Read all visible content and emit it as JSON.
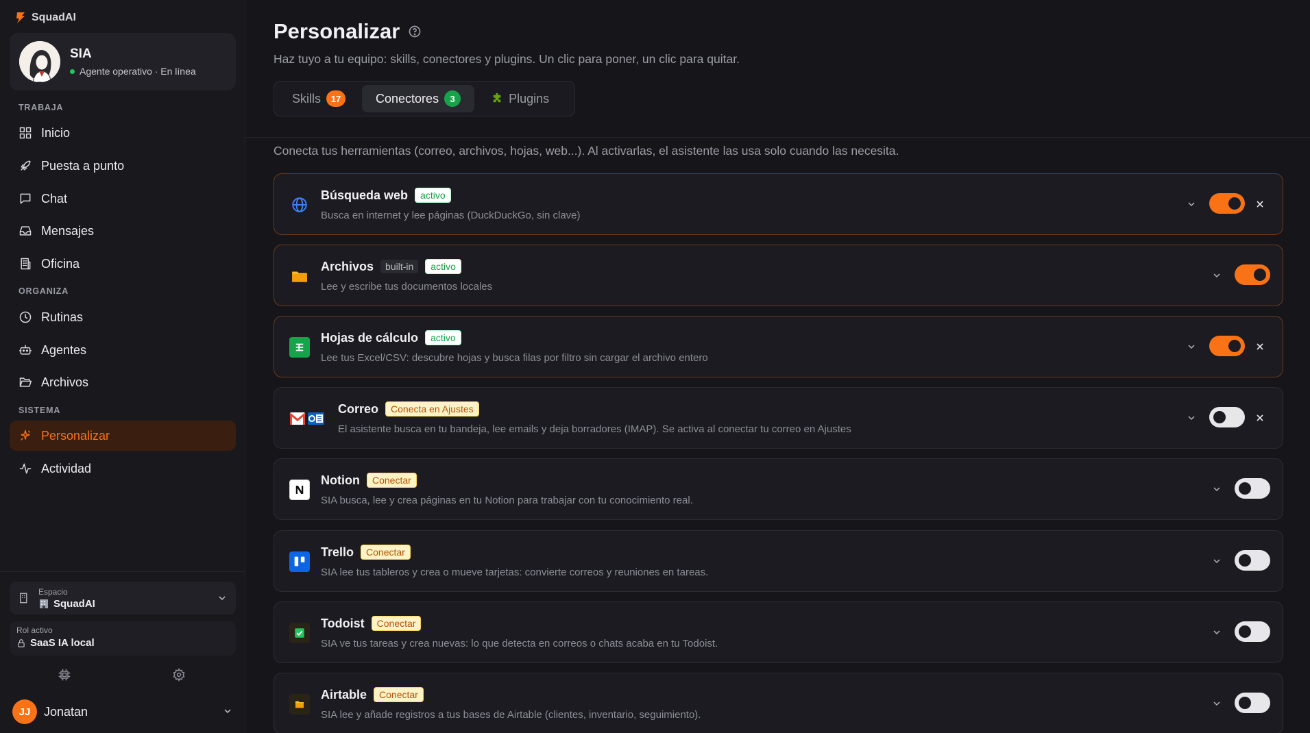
{
  "brand": {
    "name": "SquadAI"
  },
  "agent": {
    "name": "SIA",
    "status": "Agente operativo · En línea"
  },
  "sections": {
    "work": "TRABAJA",
    "organize": "ORGANIZA",
    "system": "SISTEMA"
  },
  "nav": {
    "inicio": "Inicio",
    "puesta": "Puesta a punto",
    "chat": "Chat",
    "mensajes": "Mensajes",
    "oficina": "Oficina",
    "rutinas": "Rutinas",
    "agentes": "Agentes",
    "archivos": "Archivos",
    "personalizar": "Personalizar",
    "actividad": "Actividad"
  },
  "workspace": {
    "label": "Espacio",
    "value": "SquadAI"
  },
  "role": {
    "label": "Rol activo",
    "value": "SaaS IA local"
  },
  "user": {
    "initials": "JJ",
    "name": "Jonatan"
  },
  "page": {
    "title": "Personalizar",
    "subtitle": "Haz tuyo a tu equipo: skills, conectores y plugins. Un clic para poner, un clic para quitar.",
    "intro": "Conecta tus herramientas (correo, archivos, hojas, web...). Al activarlas, el asistente las usa solo cuando las necesita."
  },
  "tabs": [
    {
      "label": "Skills",
      "count": "17"
    },
    {
      "label": "Conectores",
      "count": "3"
    },
    {
      "label": "Plugins"
    }
  ],
  "connectors": [
    {
      "title": "Búsqueda web",
      "badge": "activo",
      "desc": "Busca en internet y lee páginas (DuckDuckGo, sin clave)",
      "enabled": true,
      "icon": "globe-icon"
    },
    {
      "title": "Archivos",
      "tag": "built-in",
      "badge": "activo",
      "desc": "Lee y escribe tus documentos locales",
      "enabled": true,
      "icon": "folder-icon"
    },
    {
      "title": "Hojas de cálculo",
      "badge": "activo",
      "desc": "Lee tus Excel/CSV: descubre hojas y busca filas por filtro sin cargar el archivo entero",
      "enabled": true,
      "icon": "spreadsheet-icon"
    },
    {
      "title": "Correo",
      "badge": "Conecta en Ajustes",
      "desc": "El asistente busca en tu bandeja, lee emails y deja borradores (IMAP). Se activa al conectar tu correo en Ajustes",
      "enabled": false,
      "icon": "mail-icon"
    },
    {
      "title": "Notion",
      "badge": "Conectar",
      "desc": "SIA busca, lee y crea páginas en tu Notion para trabajar con tu conocimiento real.",
      "enabled": false,
      "icon": "notion-icon"
    },
    {
      "title": "Trello",
      "badge": "Conectar",
      "desc": "SIA lee tus tableros y crea o mueve tarjetas: convierte correos y reuniones en tareas.",
      "enabled": false,
      "icon": "trello-icon"
    },
    {
      "title": "Todoist",
      "badge": "Conectar",
      "desc": "SIA ve tus tareas y crea nuevas: lo que detecta en correos o chats acaba en tu Todoist.",
      "enabled": false,
      "icon": "todoist-icon"
    },
    {
      "title": "Airtable",
      "badge": "Conectar",
      "desc": "SIA lee y añade registros a tus bases de Airtable (clientes, inventario, seguimiento).",
      "enabled": false,
      "icon": "airtable-icon"
    }
  ],
  "colors": {
    "accent": "#f97316",
    "active_green": "#16a34a",
    "background": "#15151a"
  }
}
